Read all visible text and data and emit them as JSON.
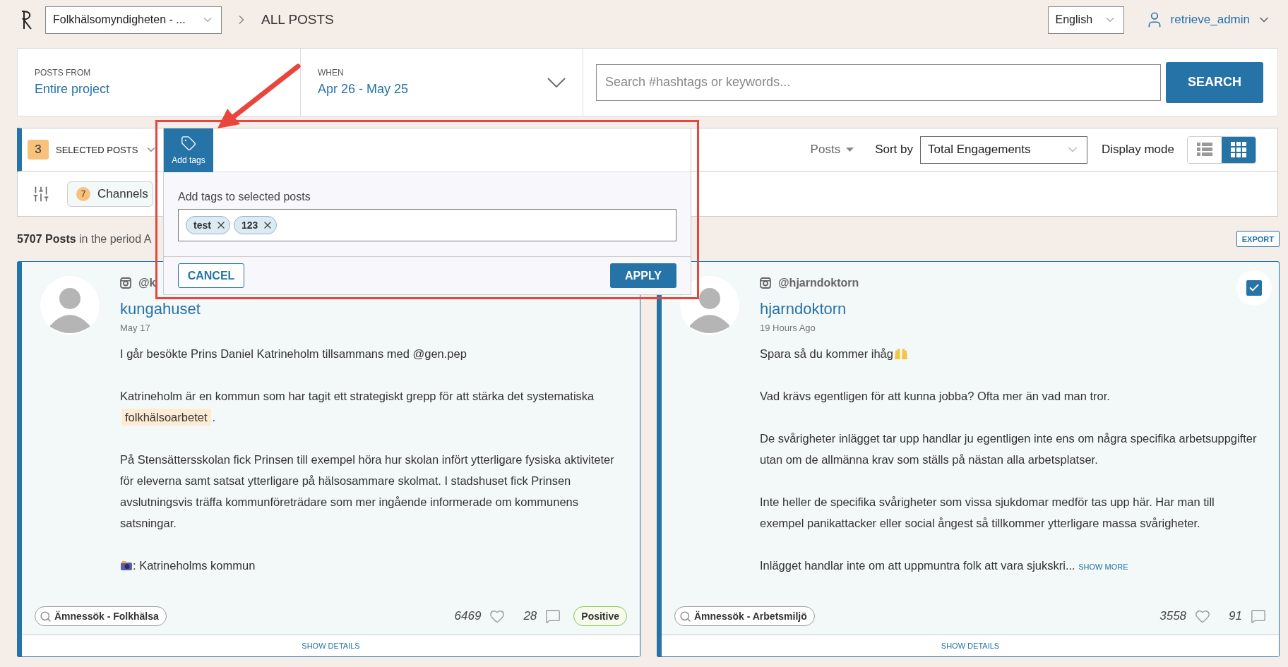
{
  "header": {
    "project": "Folkhälsomyndigheten - ...",
    "page_title": "ALL POSTS",
    "language": "English",
    "user": "retrieve_admin"
  },
  "filters": {
    "posts_from": {
      "label": "POSTS FROM",
      "value": "Entire project"
    },
    "when": {
      "label": "WHEN",
      "value": "Apr 26 - May 25"
    },
    "search": {
      "placeholder": "Search #hashtags or keywords...",
      "button": "SEARCH"
    }
  },
  "toolbar": {
    "selected_count": "3",
    "selected_label": "SELECTED POSTS",
    "posts_menu": "Posts",
    "sort_label": "Sort by",
    "sort_value": "Total Engagements",
    "display_label": "Display mode",
    "display_modes": [
      {
        "kind": "list",
        "selected": false
      },
      {
        "kind": "grid",
        "selected": true
      }
    ]
  },
  "filter_row": {
    "channels_count": "7",
    "channels_label": "Channels"
  },
  "summary": "**5707 Posts** in the period A",
  "export": "EXPORT",
  "add_tags_popup": {
    "tab": "Add tags",
    "label": "Add tags to selected posts",
    "tags": [
      {
        "text": "test"
      },
      {
        "text": "123"
      }
    ],
    "cancel": "CANCEL",
    "apply": "APPLY"
  },
  "posts": [
    {
      "handle": "@k",
      "name": "kungahuset",
      "date": "May 17",
      "paragraphs": [
        {
          "parts": [
            {
              "kind": "text",
              "text": "I går besökte Prins Daniel Katrineholm tillsammans med @gen.pep"
            }
          ]
        },
        {
          "parts": [
            {
              "kind": "text",
              "text": "Katrineholm är en kommun som har tagit ett strategiskt grepp för att stärka det systematiska "
            },
            {
              "kind": "highlight",
              "text": "folkhälsoarbetet"
            },
            {
              "kind": "text",
              "text": "."
            }
          ]
        },
        {
          "parts": [
            {
              "kind": "text",
              "text": "På Stensättersskolan fick Prinsen till exempel höra hur skolan infört ytterligare fysiska aktiviteter för eleverna samt satsat ytterligare på hälsosammare skolmat. I stadshuset fick Prinsen avslutningsvis träffa kommunföreträdare som mer ingående informerade om kommunens satsningar."
            }
          ]
        },
        {
          "parts": [
            {
              "kind": "camera"
            },
            {
              "kind": "text",
              "text": ": Katrineholms kommun"
            }
          ]
        }
      ],
      "topic": "Ämnessök - Folkhälsa",
      "likes": "6469",
      "comments": "28",
      "sentiment": "Positive",
      "details": "SHOW DETAILS"
    },
    {
      "handle": "@hjarndoktorn",
      "name": "hjarndoktorn",
      "date": "19 Hours Ago",
      "selected": true,
      "paragraphs": [
        {
          "parts": [
            {
              "kind": "text",
              "text": "Spara så du kommer ihåg"
            },
            {
              "kind": "hands"
            }
          ]
        },
        {
          "parts": [
            {
              "kind": "text",
              "text": "Vad krävs egentligen för att kunna jobba? Ofta mer än vad man tror."
            }
          ]
        },
        {
          "parts": [
            {
              "kind": "text",
              "text": "De svårigheter inlägget tar upp handlar ju egentligen inte ens om några specifika arbetsuppgifter utan om de allmänna krav som ställs på nästan alla arbetsplatser."
            }
          ]
        },
        {
          "parts": [
            {
              "kind": "text",
              "text": "Inte heller de specifika svårigheter som vissa sjukdomar medför tas upp här. Har man till exempel panikattacker eller social ångest så tillkommer ytterligare massa svårigheter."
            }
          ]
        },
        {
          "parts": [
            {
              "kind": "text",
              "text": "Inlägget handlar inte om att uppmuntra folk att vara sjukskri... "
            },
            {
              "kind": "more",
              "text": "SHOW MORE"
            }
          ]
        }
      ],
      "topic": "Ämnessök - Arbetsmiljö",
      "likes": "3558",
      "comments": "91",
      "details": "SHOW DETAILS"
    }
  ]
}
